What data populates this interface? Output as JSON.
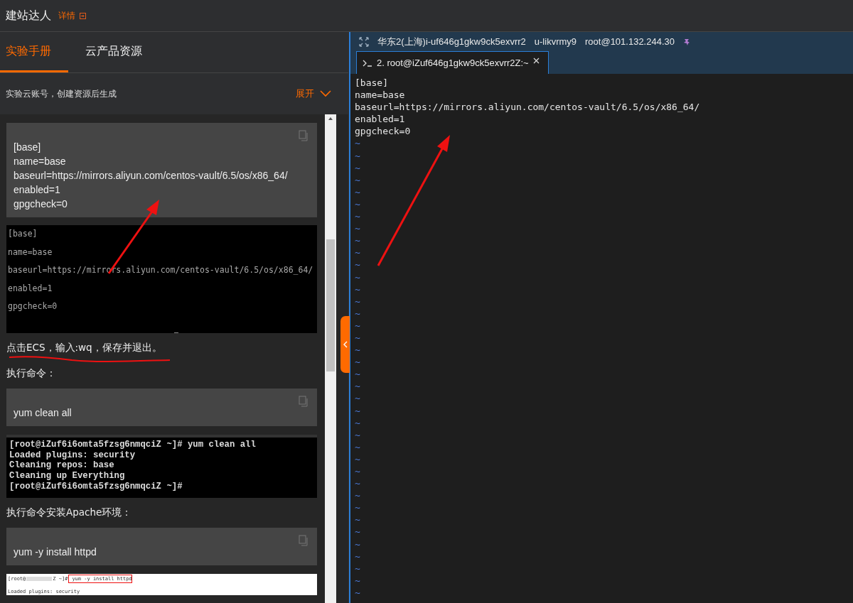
{
  "header": {
    "title": "建站达人",
    "details_link": "详情"
  },
  "left_tabs": [
    {
      "label": "实验手册",
      "selected": true
    },
    {
      "label": "云产品资源",
      "selected": false
    }
  ],
  "account": {
    "text": "实验云账号，创建资源后生成",
    "expand_label": "展开"
  },
  "manual": [
    {
      "kind": "code",
      "lines": [
        "[base]",
        "name=base",
        "baseurl=https://mirrors.aliyun.com/centos-vault/6.5/os/x86_64/",
        "enabled=1",
        "gpgcheck=0"
      ]
    },
    {
      "kind": "shot_spaced",
      "lines": [
        "[base]",
        "name=base",
        "baseurl=https://mirrors.aliyun.com/centos-vault/6.5/os/x86_64/",
        "enabled=1",
        "gpgcheck=0"
      ]
    },
    {
      "kind": "text",
      "text": "点击ECS，输入:wq，保存并退出。",
      "underlined": true
    },
    {
      "kind": "text",
      "text": "执行命令：",
      "underlined": false
    },
    {
      "kind": "code",
      "lines": [
        "yum clean all"
      ]
    },
    {
      "kind": "shot_console",
      "lines": [
        "[root@iZuf6i6omta5fzsg6nmqciZ ~]# yum clean all",
        "Loaded plugins: security",
        "Cleaning repos: base",
        "Cleaning up Everything",
        "[root@iZuf6i6omta5fzsg6nmqciZ ~]#"
      ]
    },
    {
      "kind": "text",
      "text": "执行命令安装Apache环境：",
      "underlined": false
    },
    {
      "kind": "code",
      "lines": [
        "yum -y install httpd"
      ]
    },
    {
      "kind": "shot_light",
      "prompt_start": "[root@",
      "prompt_end": "Z ~]#",
      "command": "yum -y install httpd",
      "lines": [
        "Loaded plugins: security"
      ]
    }
  ],
  "terminal": {
    "instance": "华东2(上海)i-uf646g1gkw9ck5exvrr2",
    "user": "u-likvrmy9",
    "login": "root@101.132.244.30",
    "tabs": [
      {
        "label": "2. root@iZuf646g1gkw9ck5exvrr2Z:~",
        "selected": true
      }
    ],
    "lines": [
      "[base]",
      "name=base",
      "baseurl=https://mirrors.aliyun.com/centos-vault/6.5/os/x86_64/",
      "enabled=1",
      "gpgcheck=0"
    ],
    "tildes": [
      "~",
      "~",
      "~",
      "~",
      "~",
      "~",
      "~",
      "~",
      "~",
      "~",
      "~",
      "~",
      "~",
      "~",
      "~",
      "~",
      "~",
      "~",
      "~",
      "~",
      "~",
      "~",
      "~",
      "~",
      "~",
      "~",
      "~",
      "~",
      "~",
      "~",
      "~",
      "~",
      "~",
      "~",
      "~",
      "~",
      "~",
      "~"
    ]
  }
}
